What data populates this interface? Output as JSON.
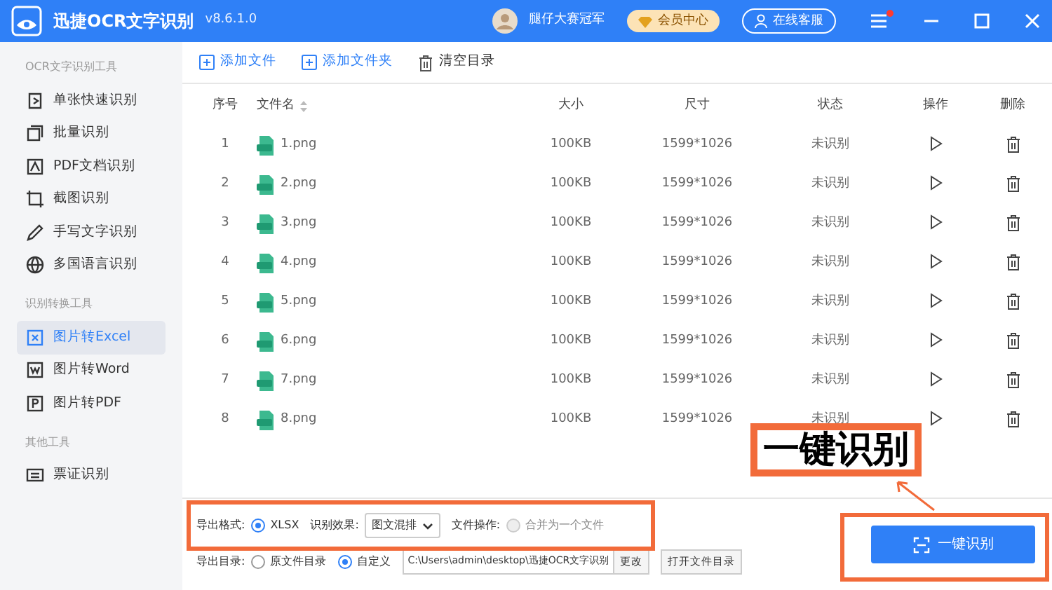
{
  "app": {
    "title": "迅捷OCR文字识别",
    "version": "v8.6.1.0",
    "user": "腿仔大赛冠军",
    "vip": "会员中心",
    "support": "在线客服",
    "menu_badge": true
  },
  "sidebar": [
    {
      "heading": "OCR文字识别工具",
      "items": [
        {
          "label": "单张快速识别",
          "selected": false
        },
        {
          "label": "批量识别",
          "selected": false
        },
        {
          "label": "PDF文档识别",
          "selected": false
        },
        {
          "label": "截图识别",
          "selected": false
        },
        {
          "label": "手写文字识别",
          "selected": false
        },
        {
          "label": "多国语言识别",
          "selected": false
        }
      ]
    },
    {
      "heading": "识别转换工具",
      "items": [
        {
          "label": "图片转Excel",
          "selected": true
        },
        {
          "label": "图片转Word",
          "selected": false
        },
        {
          "label": "图片转PDF",
          "selected": false
        }
      ]
    },
    {
      "heading": "其他工具",
      "items": [
        {
          "label": "票证识别",
          "selected": false
        }
      ]
    }
  ],
  "toolbar": [
    {
      "label": "添加文件",
      "kind": "add"
    },
    {
      "label": "添加文件夹",
      "kind": "add"
    },
    {
      "label": "清空目录",
      "kind": "clear"
    }
  ],
  "table": {
    "columns": [
      "序号",
      "文件名",
      "大小",
      "尺寸",
      "状态",
      "操作",
      "删除"
    ],
    "rows": [
      {
        "index": "1",
        "name": "1.png",
        "size": "100KB",
        "dims": "1599*1026",
        "status": "未识别"
      },
      {
        "index": "2",
        "name": "2.png",
        "size": "100KB",
        "dims": "1599*1026",
        "status": "未识别"
      },
      {
        "index": "3",
        "name": "3.png",
        "size": "100KB",
        "dims": "1599*1026",
        "status": "未识别"
      },
      {
        "index": "4",
        "name": "4.png",
        "size": "100KB",
        "dims": "1599*1026",
        "status": "未识别"
      },
      {
        "index": "5",
        "name": "5.png",
        "size": "100KB",
        "dims": "1599*1026",
        "status": "未识别"
      },
      {
        "index": "6",
        "name": "6.png",
        "size": "100KB",
        "dims": "1599*1026",
        "status": "未识别"
      },
      {
        "index": "7",
        "name": "7.png",
        "size": "100KB",
        "dims": "1599*1026",
        "status": "未识别"
      },
      {
        "index": "8",
        "name": "8.png",
        "size": "100KB",
        "dims": "1599*1026",
        "status": "未识别"
      }
    ]
  },
  "export": {
    "format_label": "导出格式:",
    "format": {
      "label": "XLSX",
      "checked": true
    },
    "effect_label": "识别效果:",
    "effect": "图文混排",
    "file_op_label": "文件操作:",
    "merge": {
      "label": "合并为一个文件",
      "checked": false,
      "disabled": true
    },
    "dir_label": "导出目录:",
    "dir_options": [
      {
        "label": "原文件目录",
        "selected": false
      },
      {
        "label": "自定义",
        "selected": true
      }
    ],
    "path": "C:\\Users\\admin\\desktop\\迅捷OCR文字识别",
    "change": "更改",
    "open_dir": "打开文件目录"
  },
  "start_button": "一键识别",
  "annotations": {
    "highlight_frames": true,
    "callout": "一键识别"
  }
}
